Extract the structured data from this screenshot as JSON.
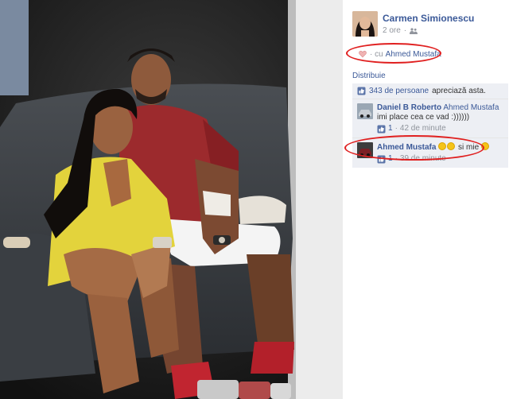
{
  "post": {
    "author": "Carmen Simionescu",
    "time": "2 ore",
    "separator": "·",
    "with_prefix": "· cu",
    "with_person": "Ahmed Mustafa",
    "share": "Distribuie"
  },
  "likes": {
    "count": "343 de persoane",
    "text": "apreciază asta."
  },
  "comments": [
    {
      "name": "Daniel B Roberto",
      "tag": "Ahmed Mustafa",
      "text": "imi place cea ce vad :))))))",
      "likes": "1",
      "time": "42 de minute",
      "avatar_icon": "car-thumbnail"
    },
    {
      "name": "Ahmed Mustafa",
      "text": "si mie",
      "likes": "1",
      "time": "39 de minute",
      "avatar_icon": "car-thumbnail"
    }
  ],
  "colors": {
    "link": "#3b5998",
    "annotation_oval": "#e01f1f",
    "comment_bg": "#edeff4"
  }
}
